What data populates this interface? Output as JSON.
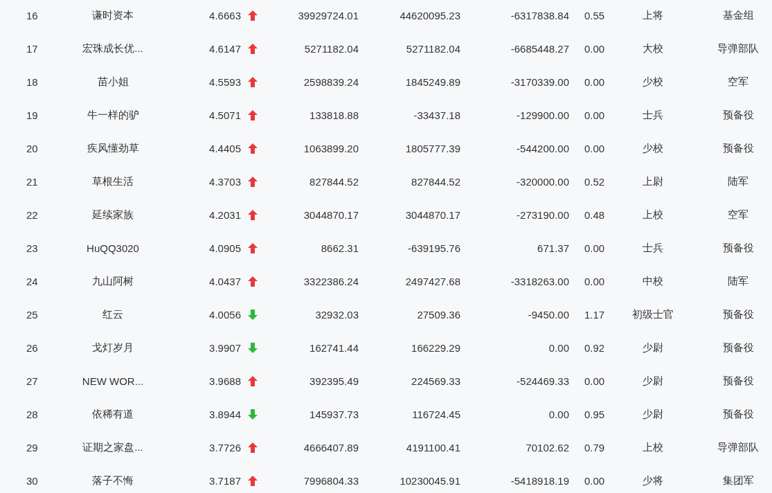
{
  "table": {
    "rows": [
      {
        "rank": "16",
        "name": "谦时资本",
        "score": "4.6663",
        "rising": true,
        "column_4": "39929724.01",
        "column_5": "44620095.23",
        "column_6": "-6317838.84",
        "column_7": "0.55",
        "column_8": "上将",
        "column_9": "基金组"
      },
      {
        "rank": "17",
        "name": "宏珠成长优...",
        "score": "4.6147",
        "rising": true,
        "column_4": "5271182.04",
        "column_5": "5271182.04",
        "column_6": "-6685448.27",
        "column_7": "0.00",
        "column_8": "大校",
        "column_9": "导弹部队"
      },
      {
        "rank": "18",
        "name": "苗小姐",
        "score": "4.5593",
        "rising": true,
        "column_4": "2598839.24",
        "column_5": "1845249.89",
        "column_6": "-3170339.00",
        "column_7": "0.00",
        "column_8": "少校",
        "column_9": "空军"
      },
      {
        "rank": "19",
        "name": "牛一样的驴",
        "score": "4.5071",
        "rising": true,
        "column_4": "133818.88",
        "column_5": "-33437.18",
        "column_6": "-129900.00",
        "column_7": "0.00",
        "column_8": "士兵",
        "column_9": "预备役"
      },
      {
        "rank": "20",
        "name": "疾风懂劲草",
        "score": "4.4405",
        "rising": true,
        "column_4": "1063899.20",
        "column_5": "1805777.39",
        "column_6": "-544200.00",
        "column_7": "0.00",
        "column_8": "少校",
        "column_9": "预备役"
      },
      {
        "rank": "21",
        "name": "草根生活",
        "score": "4.3703",
        "rising": true,
        "column_4": "827844.52",
        "column_5": "827844.52",
        "column_6": "-320000.00",
        "column_7": "0.52",
        "column_8": "上尉",
        "column_9": "陆军"
      },
      {
        "rank": "22",
        "name": "延续家族",
        "score": "4.2031",
        "rising": true,
        "column_4": "3044870.17",
        "column_5": "3044870.17",
        "column_6": "-273190.00",
        "column_7": "0.48",
        "column_8": "上校",
        "column_9": "空军"
      },
      {
        "rank": "23",
        "name": "HuQQ3020",
        "score": "4.0905",
        "rising": true,
        "column_4": "8662.31",
        "column_5": "-639195.76",
        "column_6": "671.37",
        "column_7": "0.00",
        "column_8": "士兵",
        "column_9": "预备役"
      },
      {
        "rank": "24",
        "name": "九山阿树",
        "score": "4.0437",
        "rising": true,
        "column_4": "3322386.24",
        "column_5": "2497427.68",
        "column_6": "-3318263.00",
        "column_7": "0.00",
        "column_8": "中校",
        "column_9": "陆军"
      },
      {
        "rank": "25",
        "name": "红云",
        "score": "4.0056",
        "rising": false,
        "column_4": "32932.03",
        "column_5": "27509.36",
        "column_6": "-9450.00",
        "column_7": "1.17",
        "column_8": "初级士官",
        "column_9": "预备役"
      },
      {
        "rank": "26",
        "name": "戈灯岁月",
        "score": "3.9907",
        "rising": false,
        "column_4": "162741.44",
        "column_5": "166229.29",
        "column_6": "0.00",
        "column_7": "0.92",
        "column_8": "少尉",
        "column_9": "预备役"
      },
      {
        "rank": "27",
        "name": "NEW WOR...",
        "score": "3.9688",
        "rising": true,
        "column_4": "392395.49",
        "column_5": "224569.33",
        "column_6": "-524469.33",
        "column_7": "0.00",
        "column_8": "少尉",
        "column_9": "预备役"
      },
      {
        "rank": "28",
        "name": "依稀有道",
        "score": "3.8944",
        "rising": false,
        "column_4": "145937.73",
        "column_5": "116724.45",
        "column_6": "0.00",
        "column_7": "0.95",
        "column_8": "少尉",
        "column_9": "预备役"
      },
      {
        "rank": "29",
        "name": "证期之家盘...",
        "score": "3.7726",
        "rising": true,
        "column_4": "4666407.89",
        "column_5": "4191100.41",
        "column_6": "70102.62",
        "column_7": "0.79",
        "column_8": "上校",
        "column_9": "导弹部队"
      },
      {
        "rank": "30",
        "name": "落子不悔",
        "score": "3.7187",
        "rising": true,
        "column_4": "7996804.33",
        "column_5": "10230045.91",
        "column_6": "-5418918.19",
        "column_7": "0.00",
        "column_8": "少将",
        "column_9": "集团军"
      }
    ]
  }
}
